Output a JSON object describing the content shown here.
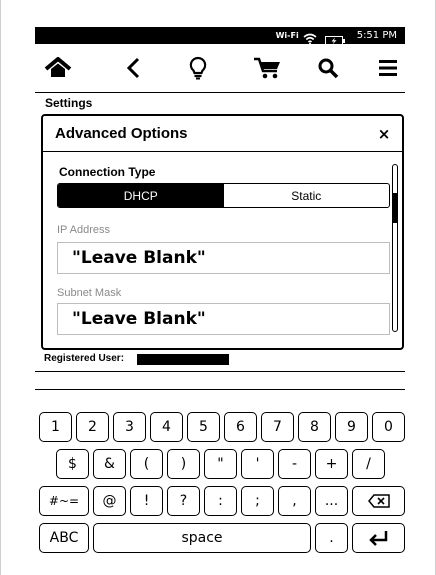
{
  "status_bar": {
    "wifi_text": "Wi-Fi",
    "time": "5:51 PM",
    "icons": [
      "wifi-icon",
      "battery-charging-icon"
    ]
  },
  "toolbar": {
    "buttons": [
      "home-icon",
      "back-icon",
      "lightbulb-icon",
      "cart-icon",
      "search-icon",
      "menu-icon"
    ]
  },
  "breadcrumb": "Settings",
  "dialog": {
    "title": "Advanced Options",
    "close_label": "×",
    "connection_type_label": "Connection Type",
    "segments": [
      {
        "label": "DHCP",
        "selected": true
      },
      {
        "label": "Static",
        "selected": false
      }
    ],
    "ip_address": {
      "label": "IP Address",
      "value": "\"Leave Blank\""
    },
    "subnet_mask": {
      "label": "Subnet Mask",
      "value": "\"Leave Blank\""
    }
  },
  "registered_user_label": "Registered User:",
  "keyboard": {
    "row1": [
      "1",
      "2",
      "3",
      "4",
      "5",
      "6",
      "7",
      "8",
      "9",
      "0"
    ],
    "row2": [
      "$",
      "&",
      "(",
      ")",
      "\"",
      "'",
      "-",
      "+",
      "/"
    ],
    "row3": [
      "#~=",
      "@",
      "!",
      "?",
      ":",
      ";",
      ",",
      "..."
    ],
    "backspace_icon": "backspace-icon",
    "abc_label": "ABC",
    "space_label": "space",
    "period_label": ".",
    "enter_icon": "enter-icon"
  },
  "colors": {
    "accent": "#000000",
    "muted_label": "#8a8a8a",
    "field_border": "#bdbdbd"
  }
}
